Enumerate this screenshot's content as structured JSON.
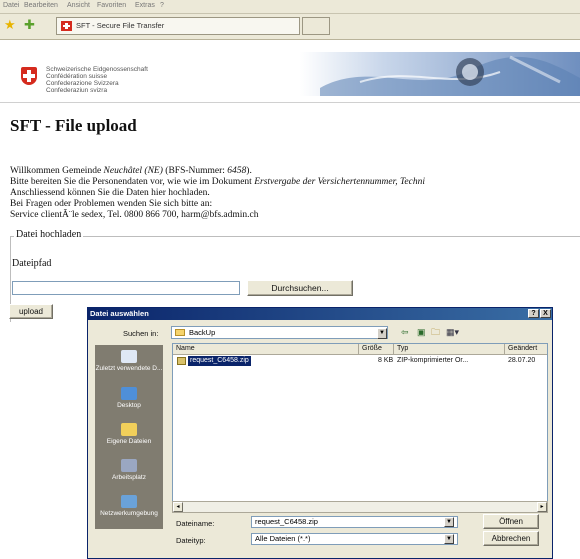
{
  "browser": {
    "menu": [
      "Datei",
      "Bearbeiten",
      "Ansicht",
      "Favoriten",
      "Extras",
      "?"
    ],
    "tab_title": "SFT - Secure File Transfer"
  },
  "header": {
    "confederation": [
      "Schweizerische Eidgenossenschaft",
      "Confédération suisse",
      "Confederazione Svizzera",
      "Confederaziun svizra"
    ]
  },
  "page": {
    "title": "SFT - File upload",
    "line1_pre": "Willkommen Gemeinde ",
    "line1_municipality": "Neuchâtel (NE)",
    "line1_mid": " (BFS-Nummer: ",
    "line1_number": "6458",
    "line1_post": ").",
    "line2_pre": "Bitte bereiten Sie die Personendaten vor, wie wie im Dokument ",
    "line2_doc": "Erstvergabe der Versichertennummer, Techni",
    "line3": "Anschliessend können Sie die Daten hier hochladen.",
    "line4": "Bei Fragen oder Problemen wenden Sie sich bitte an:",
    "line5": "Service clientÃ¨le sedex, Tel. 0800 866 700, harm@bfs.admin.ch"
  },
  "upload_form": {
    "legend": "Datei hochladen",
    "path_label": "Dateipfad",
    "path_value": "",
    "browse_label": "Durchsuchen...",
    "upload_label": "upload"
  },
  "dialog": {
    "title": "Datei auswählen",
    "title_buttons": [
      "?",
      "X"
    ],
    "lookin_label": "Suchen in:",
    "lookin_value": "BackUp",
    "places": [
      "Zuletzt verwendete D...",
      "Desktop",
      "Eigene Dateien",
      "Arbeitsplatz",
      "Netzwerkumgebung"
    ],
    "columns": {
      "name": "Name",
      "size": "Größe",
      "type": "Typ",
      "changed": "Geändert"
    },
    "files": [
      {
        "name": "request_C6458.zip",
        "size": "8 KB",
        "type": "ZIP-komprimierter Or...",
        "changed": "28.07.20"
      }
    ],
    "filename_label": "Dateiname:",
    "filename_value": "request_C6458.zip",
    "filetype_label": "Dateityp:",
    "filetype_value": "Alle Dateien (*.*)",
    "open_label": "Öffnen",
    "cancel_label": "Abbrechen"
  }
}
